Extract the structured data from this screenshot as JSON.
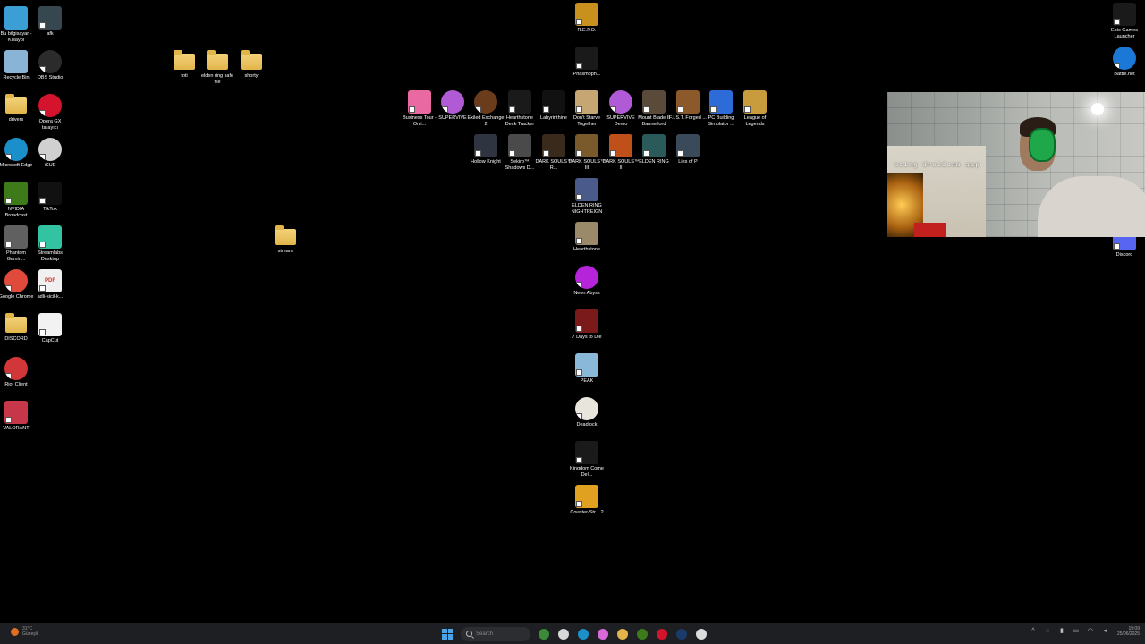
{
  "desktop": {
    "icons": [
      {
        "label": "Bu bilgisayar - Kısayol",
        "kind": "monitor",
        "color": "#3b9fd6"
      },
      {
        "label": "afk",
        "kind": "image",
        "color": "#36474f"
      },
      {
        "label": "Recycle Bin",
        "kind": "recycle",
        "color": "#8ab4d6"
      },
      {
        "label": "OBS Studio",
        "kind": "round",
        "color": "#2b2b2b"
      },
      {
        "label": "drivers",
        "kind": "folder",
        "color": "#e2b54a"
      },
      {
        "label": "Opera GX tarayıcı",
        "kind": "round",
        "color": "#d4132c"
      },
      {
        "label": "Microsoft Edge",
        "kind": "round",
        "color": "#1b8fc9"
      },
      {
        "label": "iCUE",
        "kind": "round",
        "color": "#d0d0d0"
      },
      {
        "label": "NVIDIA Broadcast",
        "kind": "app",
        "color": "#3c7a1a"
      },
      {
        "label": "TikTok",
        "kind": "app",
        "color": "#111111"
      },
      {
        "label": "Phantom Gamin...",
        "kind": "app",
        "color": "#606060"
      },
      {
        "label": "Streamlabs Desktop",
        "kind": "app",
        "color": "#31c3a2"
      },
      {
        "label": "Google Chrome",
        "kind": "round",
        "color": "#e04a3b"
      },
      {
        "label": "adli-sicil-k...",
        "kind": "pdf",
        "color": "#d0342c"
      },
      {
        "label": "DISCORD",
        "kind": "folder",
        "color": "#e2b54a"
      },
      {
        "label": "CapCut",
        "kind": "app",
        "color": "#f2f2f2"
      },
      {
        "label": "Riot Client",
        "kind": "round",
        "color": "#d13639"
      },
      {
        "label": "VALORANT",
        "kind": "app",
        "color": "#c7374a"
      },
      {
        "label": "foti",
        "kind": "folder",
        "color": "#e2b54a"
      },
      {
        "label": "elden ring safe file",
        "kind": "folder",
        "color": "#e2b54a"
      },
      {
        "label": "shorty",
        "kind": "folder",
        "color": "#e2b54a"
      },
      {
        "label": "stream",
        "kind": "folder",
        "color": "#e2b54a"
      },
      {
        "label": "R.E.P.O.",
        "kind": "app",
        "color": "#c8911e"
      },
      {
        "label": "Phasmoph...",
        "kind": "app",
        "color": "#1a1a1a"
      },
      {
        "label": "Business Tour - Onli...",
        "kind": "app",
        "color": "#e96aa3"
      },
      {
        "label": "SUPERVIVE",
        "kind": "round",
        "color": "#b15ad6"
      },
      {
        "label": "Exiled Exchange 2",
        "kind": "round",
        "color": "#6b3c1c"
      },
      {
        "label": "Hearthstone Deck Tracker",
        "kind": "app",
        "color": "#1a1a1a"
      },
      {
        "label": "Labyrinthine",
        "kind": "app",
        "color": "#111111"
      },
      {
        "label": "Don't Starve Together",
        "kind": "app",
        "color": "#c6a773"
      },
      {
        "label": "SUPERVIVE Demo",
        "kind": "round",
        "color": "#b15ad6"
      },
      {
        "label": "Mount Blade II Bannerlord",
        "kind": "app",
        "color": "#5a4a3a"
      },
      {
        "label": "F.I.S.T. Forged ...",
        "kind": "app",
        "color": "#8c5a2a"
      },
      {
        "label": "PC Building Simulator ...",
        "kind": "app",
        "color": "#2c6bd8"
      },
      {
        "label": "League of Legends",
        "kind": "app",
        "color": "#c89b3c"
      },
      {
        "label": "Hollow Knight",
        "kind": "app",
        "color": "#2e3440"
      },
      {
        "label": "Sekiro™ Shadows D...",
        "kind": "app",
        "color": "#4a4a4a"
      },
      {
        "label": "DARK SOULS™ R...",
        "kind": "app",
        "color": "#3a2a1c"
      },
      {
        "label": "DARK SOULS™ III",
        "kind": "app",
        "color": "#7a5a2a"
      },
      {
        "label": "DARK SOULS™ II",
        "kind": "app",
        "color": "#c0501a"
      },
      {
        "label": "ELDEN RING",
        "kind": "app",
        "color": "#2a5a5a"
      },
      {
        "label": "Lies of P",
        "kind": "app",
        "color": "#3a4a5a"
      },
      {
        "label": "ELDEN RING NIGHTREIGN",
        "kind": "app",
        "color": "#4a5a8a"
      },
      {
        "label": "Hearthstone",
        "kind": "app",
        "color": "#9a8a6a"
      },
      {
        "label": "Neon Abyss",
        "kind": "round",
        "color": "#b524d8"
      },
      {
        "label": "7 Days to Die",
        "kind": "app",
        "color": "#7a1a1a"
      },
      {
        "label": "PEAK",
        "kind": "app",
        "color": "#8ab8d8"
      },
      {
        "label": "Deadlock",
        "kind": "round",
        "color": "#e8e6dc"
      },
      {
        "label": "Kingdom Come Del...",
        "kind": "app",
        "color": "#1a1a1a"
      },
      {
        "label": "Counter-Str... 2",
        "kind": "app",
        "color": "#e0a020"
      },
      {
        "label": "Epic Games Launcher",
        "kind": "app",
        "color": "#1a1a1a"
      },
      {
        "label": "Battle.net",
        "kind": "round",
        "color": "#1c78d6"
      },
      {
        "label": "Discord",
        "kind": "app",
        "color": "#5865f2"
      }
    ]
  },
  "webcam": {
    "caption": "using droidcam app"
  },
  "taskbar": {
    "weather_temp": "31°C",
    "weather_cond": "Güneşli",
    "search_placeholder": "Search",
    "time": "19:09",
    "date": "25/06/2025",
    "pinned": [
      {
        "name": "gallery-app",
        "color": "#3a8a3a"
      },
      {
        "name": "file-explorer-pinned",
        "color": "#d8d8d8"
      },
      {
        "name": "edge-pinned",
        "color": "#1b8fc9"
      },
      {
        "name": "copilot-app",
        "color": "#d86ad8"
      },
      {
        "name": "folder-pinned",
        "color": "#e2b54a"
      },
      {
        "name": "nvidia-app",
        "color": "#3c7a1a"
      },
      {
        "name": "opera-gx-pinned",
        "color": "#d4132c"
      },
      {
        "name": "steam-pinned",
        "color": "#1a3a6a"
      },
      {
        "name": "obs-pinned",
        "color": "#dcdcdc"
      }
    ]
  }
}
